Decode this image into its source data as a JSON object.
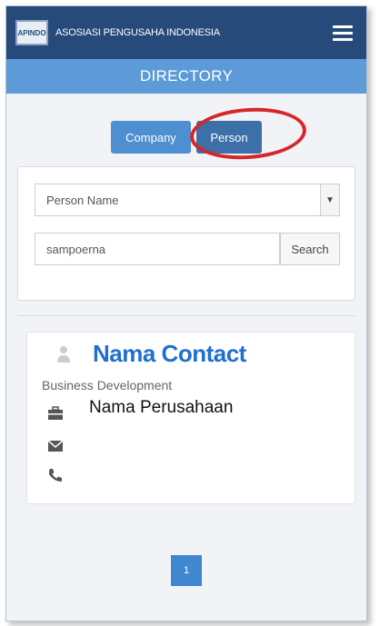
{
  "header": {
    "logo_text": "APINDO",
    "title": "ASOSIASI PENGUSAHA INDONESIA",
    "menu_icon": "hamburger-menu-icon"
  },
  "subheader": {
    "title": "DIRECTORY"
  },
  "tabs": [
    {
      "label": "Company",
      "selected": false
    },
    {
      "label": "Person",
      "selected": true
    }
  ],
  "search": {
    "select_value": "Person Name",
    "input_value": "sampoerna",
    "button_label": "Search"
  },
  "result": {
    "name": "Nama Contact",
    "role": "Business Development",
    "company": "Nama Perusahaan",
    "icons": [
      "person-icon",
      "briefcase-icon",
      "envelope-icon",
      "phone-icon"
    ]
  },
  "pagination": {
    "current_page": "1"
  },
  "colors": {
    "header_bg": "#264a7a",
    "subheader_bg": "#5c9bd8",
    "tab_bg": "#4e8fd2",
    "accent_text": "#1f6fd1",
    "highlight_ring": "#d6262a"
  }
}
